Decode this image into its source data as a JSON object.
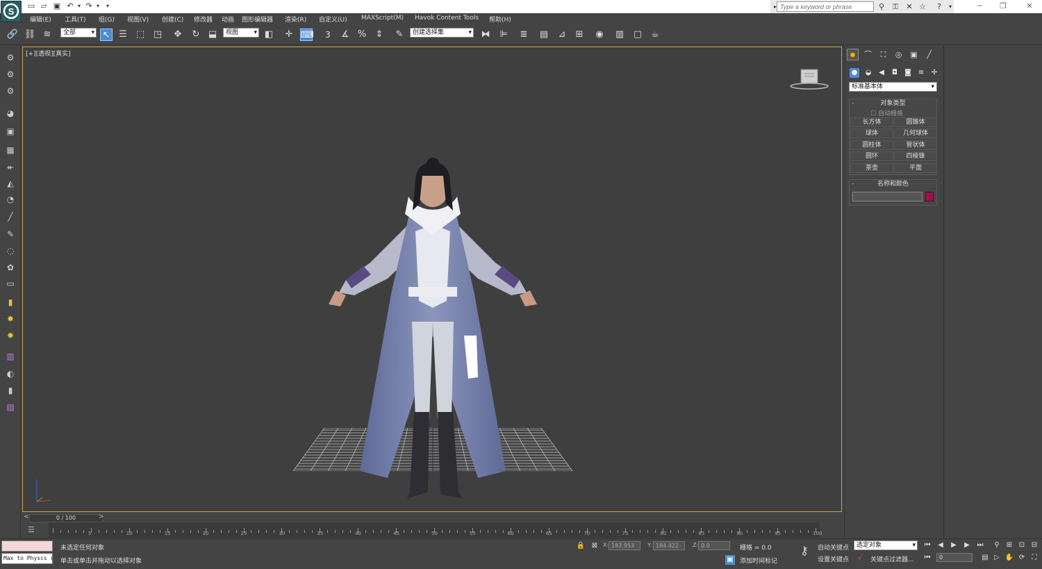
{
  "title_bar": {
    "search_placeholder": "Type a keyword or phrase"
  },
  "menu": [
    "编辑(E)",
    "工具(T)",
    "组(G)",
    "视图(V)",
    "创建(C)",
    "修改器",
    "动画",
    "图形编辑器",
    "渲染(R)",
    "自定义(U)",
    "MAXScript(M)",
    "Havok Content Tools",
    "帮助(H)"
  ],
  "toolbar": {
    "selection_filter": "全部",
    "reference_coord": "视图",
    "named_selection": "创建选择集",
    "snap_number": "3"
  },
  "viewport": {
    "label": "[+][透视][真实]"
  },
  "command_panel": {
    "category": "标准基本体",
    "object_type_title": "对象类型",
    "autogrid_label": "自动栅格",
    "objects": [
      "长方体",
      "圆锥体",
      "球体",
      "几何球体",
      "圆柱体",
      "管状体",
      "圆环",
      "四棱锥",
      "茶壶",
      "平面"
    ],
    "name_color_title": "名称和颜色",
    "object_color": "#a0104b"
  },
  "timeline": {
    "frame_display": "0 / 100",
    "ticks": [
      "5",
      "10",
      "15",
      "20",
      "25",
      "30",
      "35",
      "40",
      "45",
      "50",
      "55",
      "60",
      "65",
      "70",
      "75",
      "80",
      "85",
      "90",
      "95",
      "100"
    ]
  },
  "status": {
    "maxscript_listener": "Max to Physcs (",
    "selection_status": "未选定任何对象",
    "prompt": "单击或单击并拖动以选择对象",
    "x_label": "X:",
    "x_value": "183.953",
    "y_label": "Y:",
    "y_value": "184.422",
    "z_label": "Z:",
    "z_value": "0.0",
    "grid": "栅格 = 0.0",
    "add_time_tag": "添加时间标记",
    "auto_key": "自动关键点",
    "selected_object": "选定对象",
    "set_key": "设置关键点",
    "key_filters": "关键点过滤器...",
    "current_frame": "0"
  }
}
